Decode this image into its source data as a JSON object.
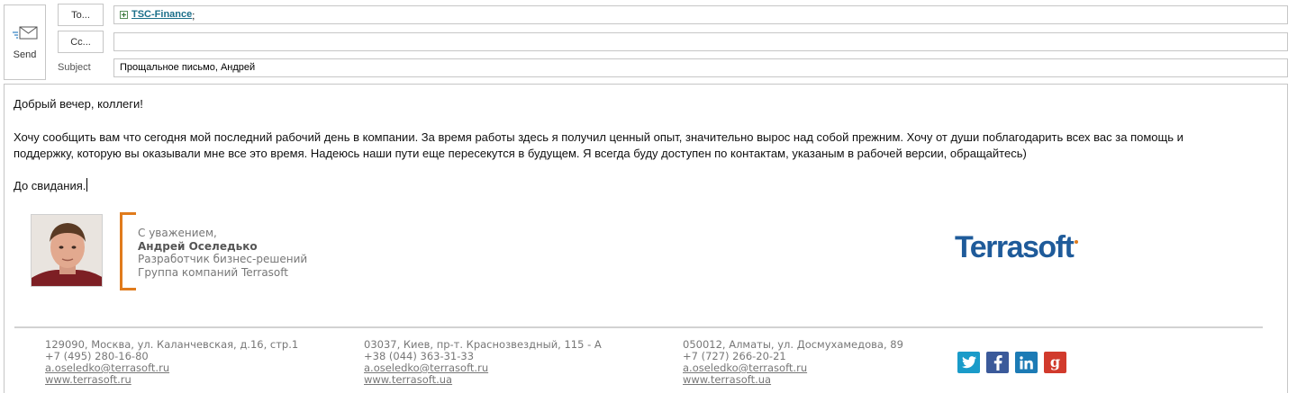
{
  "compose": {
    "send_label": "Send",
    "to_label": "To...",
    "cc_label": "Cc...",
    "subject_label": "Subject",
    "to_value": "TSC-Finance",
    "to_separator": ";",
    "cc_value": "",
    "subject_value": "Прощальное письмо, Андрей"
  },
  "message": {
    "greeting": "Добрый вечер, коллеги!",
    "paragraph_line1": "Хочу сообщить вам что сегодня мой последний рабочий день в компании. За время работы здесь я получил ценный опыт, значительно вырос над собой прежним. Хочу от души поблагодарить всех вас за помощь и",
    "paragraph_line2": "поддержку, которую вы оказывали мне все это время. Надеюсь наши пути еще пересекутся в будущем. Я всегда буду доступен по контактам, указаным в рабочей версии, обращайтесь)",
    "closing": "До свидания."
  },
  "signature": {
    "regards": "С уважением,",
    "name": "Андрей Оселедько",
    "position": "Разработчик бизнес-решений",
    "company": "Группа компаний Terrasoft",
    "logo": "Terrasoft",
    "accent_color": "#e07b1c",
    "logo_color": "#1f5b9a"
  },
  "offices": [
    {
      "address": "129090, Москва, ул. Каланчевская, д.16, стр.1",
      "phone": "+7 (495) 280-16-80",
      "email": "a.oseledko@terrasoft.ru",
      "web": "www.terrasoft.ru"
    },
    {
      "address": "03037, Киев, пр-т. Краснозвездный, 115 - А",
      "phone": "+38 (044) 363-31-33",
      "email": "a.oseledko@terrasoft.ru",
      "web": "www.terrasoft.ua"
    },
    {
      "address": "050012, Алматы, ул. Досмухамедова, 89",
      "phone": "+7 (727) 266-20-21",
      "email": "a.oseledko@terrasoft.ru",
      "web": "www.terrasoft.ua"
    }
  ],
  "social": [
    {
      "icon": "twitter-icon",
      "color": "#1a9bc9"
    },
    {
      "icon": "facebook-icon",
      "color": "#3b5a9a"
    },
    {
      "icon": "linkedin-icon",
      "color": "#1c7bb5"
    },
    {
      "icon": "google-plus-icon",
      "color": "#d13a2c"
    }
  ]
}
